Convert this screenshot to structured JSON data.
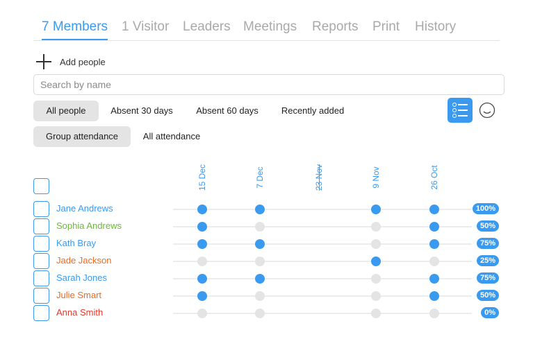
{
  "tabs": [
    {
      "label": "7 Members",
      "active": true
    },
    {
      "label": "1 Visitor",
      "active": false
    },
    {
      "label": "Leaders",
      "active": false
    },
    {
      "label": "Meetings",
      "active": false
    },
    {
      "label": "Reports",
      "active": false
    },
    {
      "label": "Print",
      "active": false
    },
    {
      "label": "History",
      "active": false
    }
  ],
  "add_people": {
    "label": "Add people",
    "icon": "plus-icon"
  },
  "search": {
    "placeholder": "Search by name",
    "value": ""
  },
  "filters": [
    {
      "label": "All people",
      "selected": true
    },
    {
      "label": "Absent 30 days",
      "selected": false
    },
    {
      "label": "Absent 60 days",
      "selected": false
    },
    {
      "label": "Recently added",
      "selected": false
    }
  ],
  "view_toggles": {
    "list_view_icon": "list-view-icon",
    "emoji_icon": "smiley-icon",
    "list_view_active": true
  },
  "attendance_modes": [
    {
      "label": "Group attendance",
      "selected": true
    },
    {
      "label": "All attendance",
      "selected": false
    }
  ],
  "dates": [
    {
      "label": "15 Dec",
      "cancelled": false
    },
    {
      "label": "7 Dec",
      "cancelled": false
    },
    {
      "label": "23 Nov",
      "cancelled": true
    },
    {
      "label": "9 Nov",
      "cancelled": false
    },
    {
      "label": "26 Oct",
      "cancelled": false
    }
  ],
  "members": [
    {
      "name": "Jane Andrews",
      "color": "#3a9af0",
      "attendance": [
        true,
        true,
        null,
        true,
        true
      ],
      "percent": "100%"
    },
    {
      "name": "Sophia Andrews",
      "color": "#6ab934",
      "attendance": [
        true,
        false,
        null,
        false,
        true
      ],
      "percent": "50%"
    },
    {
      "name": "Kath Bray",
      "color": "#3a9af0",
      "attendance": [
        true,
        true,
        null,
        false,
        true
      ],
      "percent": "75%"
    },
    {
      "name": "Jade Jackson",
      "color": "#ee6b1d",
      "attendance": [
        false,
        false,
        null,
        true,
        false
      ],
      "percent": "25%"
    },
    {
      "name": "Sarah Jones",
      "color": "#3a9af0",
      "attendance": [
        true,
        true,
        null,
        false,
        true
      ],
      "percent": "75%"
    },
    {
      "name": "Julie Smart",
      "color": "#ee6b1d",
      "attendance": [
        true,
        false,
        null,
        false,
        true
      ],
      "percent": "50%"
    },
    {
      "name": "Anna Smith",
      "color": "#e03a2b",
      "attendance": [
        false,
        false,
        null,
        false,
        false
      ],
      "percent": "0%"
    }
  ],
  "colors": {
    "accent": "#3a9af0",
    "attended": "#3a9af0",
    "absent": "#e4e4e4"
  }
}
